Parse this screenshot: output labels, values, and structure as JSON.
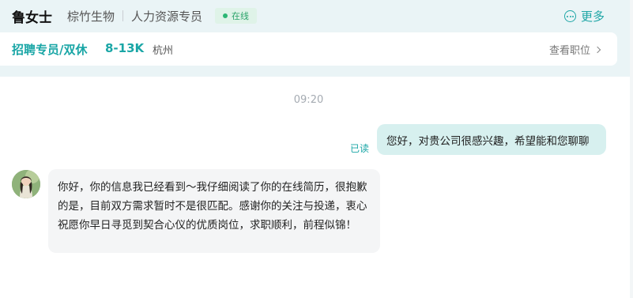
{
  "header": {
    "contact_name": "鲁女士",
    "company": "棕竹生物",
    "role": "人力资源专员",
    "status": "在线",
    "more_label": "更多"
  },
  "job": {
    "title": "招聘专员/双休",
    "salary": "8-13K",
    "city": "杭州",
    "view_label": "查看职位"
  },
  "chat": {
    "timestamp": "09:20",
    "messages": [
      {
        "direction": "outgoing",
        "read_status": "已读",
        "text": "您好，对贵公司很感兴趣，希望能和您聊聊"
      },
      {
        "direction": "incoming",
        "text": "你好，你的信息我已经看到～我仔细阅读了你的在线简历，很抱歉的是，目前双方需求暂时不是很匹配。感谢你的关注与投递，衷心祝愿你早日寻觅到契合心仪的优质岗位，求职顺利，前程似锦！"
      }
    ]
  },
  "colors": {
    "accent": "#1aa6a6",
    "online": "#2bb673",
    "top_bg": "#eaf4f6",
    "outgoing_bubble": "#d7f0ef",
    "incoming_bubble": "#f4f5f6"
  },
  "icons": [
    "more-icon",
    "chevron-right-icon",
    "avatar-image"
  ]
}
